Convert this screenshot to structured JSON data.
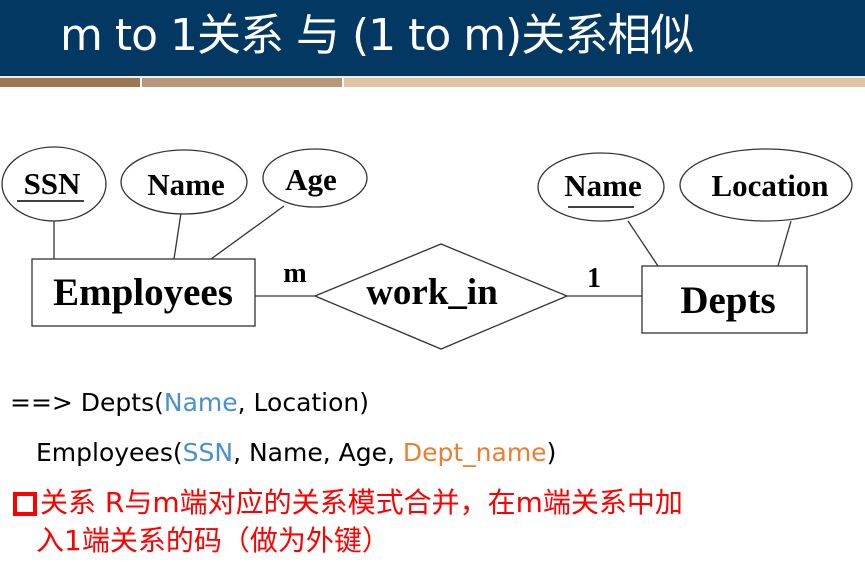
{
  "header": {
    "title": "m to 1关系 与 (1 to m)关系相似"
  },
  "diagram": {
    "entities": [
      {
        "id": "employees",
        "label": "Employees"
      },
      {
        "id": "depts",
        "label": "Depts"
      }
    ],
    "relationship": {
      "label": "work_in"
    },
    "cardinality": {
      "employees_side": "m",
      "depts_side": "1"
    },
    "attributes": {
      "employees": [
        {
          "label": "SSN",
          "key": true
        },
        {
          "label": "Name",
          "key": false
        },
        {
          "label": "Age",
          "key": false
        }
      ],
      "depts": [
        {
          "label": "Name",
          "key": true
        },
        {
          "label": "Location",
          "key": false
        }
      ]
    }
  },
  "schemas": {
    "line1": {
      "prefix": "==> Depts(",
      "key": "Name",
      "rest": ", Location)"
    },
    "line2": {
      "prefix": "Employees(",
      "key": "SSN",
      "middle": ", Name, Age, ",
      "foreign_key": "Dept_name",
      "suffix": ")"
    }
  },
  "note": {
    "line1": "关系 R与m端对应的关系模式合并，在m端关系中加",
    "line2": "入1端关系的码（做为外键）"
  },
  "colors": {
    "header_bg": "#033863",
    "key_blue": "#4a8fd0",
    "fk_orange": "#ed7d31",
    "note_red": "#ff0000"
  }
}
